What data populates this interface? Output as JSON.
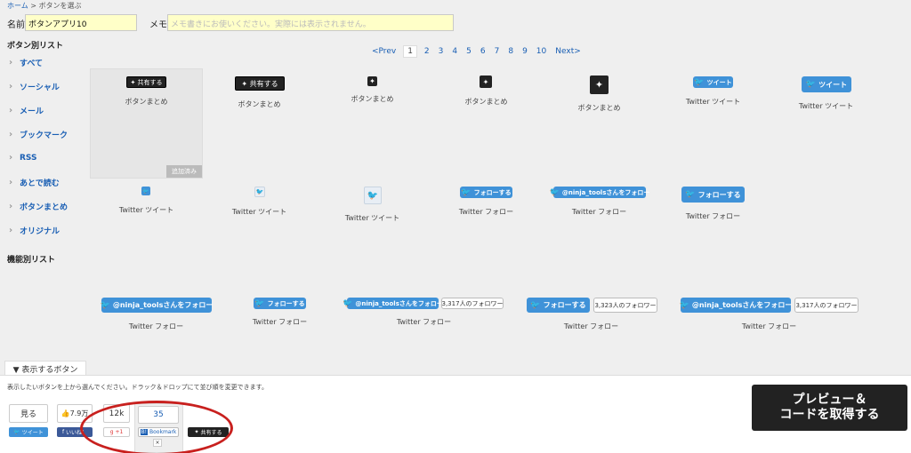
{
  "breadcrumb": {
    "home": "ホーム",
    "sep": " > ",
    "current": "ボタンを選ぶ"
  },
  "form": {
    "name_label": "名前",
    "name_value": "ボタンアプリ10",
    "memo_label": "メモ",
    "memo_placeholder": "メモ書きにお使いください。実際には表示されません。"
  },
  "sidebar": {
    "heading": "ボタン別リスト",
    "items": [
      "すべて",
      "ソーシャル",
      "メール",
      "ブックマーク",
      "RSS",
      "あとで読む",
      "ボタンまとめ",
      "オリジナル"
    ],
    "heading2": "機能別リスト"
  },
  "pager": {
    "prev": "<Prev",
    "pages": [
      "1",
      "2",
      "3",
      "4",
      "5",
      "6",
      "7",
      "8",
      "9",
      "10"
    ],
    "next": "Next>",
    "active": "1"
  },
  "grid": {
    "share_label": "共有する",
    "tweet_label": "ツイート",
    "follow_label": "フォローする",
    "ninja_follow": "@ninja_toolsさんをフォロー",
    "added_badge": "追加済み",
    "cap_matome": "ボタンまとめ",
    "cap_tweet": "Twitter ツイート",
    "cap_follow": "Twitter フォロー",
    "followers_a": "3,317人のフォロワー",
    "followers_b": "3,323人のフォロワー",
    "followers_c": "3,317人のフォロワー"
  },
  "panel": {
    "tab_label": "▼ 表示するボタン",
    "description": "表示したいボタンを上から選んでください。ドラック＆ドロップにて並び順を変更できます。",
    "preview_line1": "プレビュー＆",
    "preview_line2": "コードを取得する",
    "see_label": "見る",
    "see_sub": "ツイート",
    "like_count": "7.9万",
    "like_sub": "いいね！",
    "gplus_count": "12k",
    "gplus_sub": "+1",
    "hatebu_count": "35",
    "hatebu_sub": "Bookmark",
    "close": "×",
    "share_sub": "共有する",
    "highlight_color": "#c8201e"
  }
}
